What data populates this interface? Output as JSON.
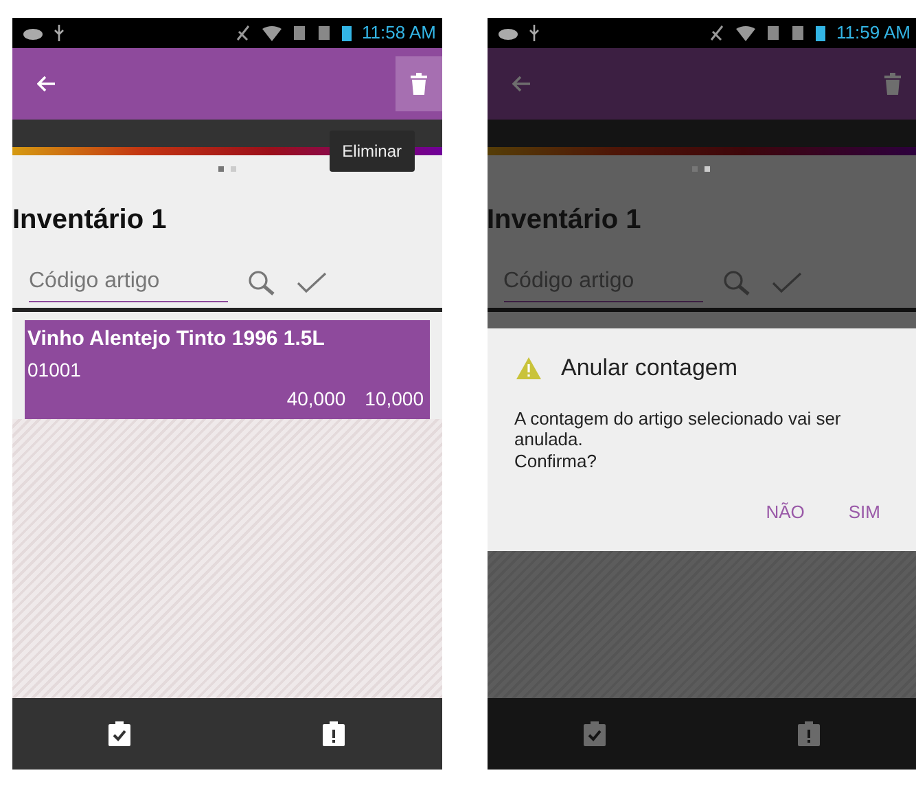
{
  "screens": [
    {
      "status_bar": {
        "time": "11:58 AM"
      },
      "app_bar": {
        "delete_pressed": true,
        "tooltip": "Eliminar"
      },
      "page_indicator": [
        {
          "selected": true
        },
        {
          "selected": false
        }
      ],
      "title": "Inventário 1",
      "search": {
        "placeholder": "Código artigo"
      },
      "items": [
        {
          "name": "Vinho Alentejo Tinto 1996 1.5L",
          "code": "01001",
          "value_1": "40,000",
          "value_2": "10,000",
          "selected": true
        }
      ]
    },
    {
      "status_bar": {
        "time": "11:59 AM"
      },
      "app_bar": {
        "delete_pressed": false
      },
      "page_indicator": [
        {
          "selected": true
        },
        {
          "selected": false
        }
      ],
      "title": "Inventário 1",
      "search": {
        "placeholder": "Código artigo"
      },
      "dialog": {
        "title": "Anular contagem",
        "message": "A contagem do artigo selecionado vai ser anulada.\nConfirma?",
        "buttons": [
          "NÃO",
          "SIM"
        ]
      }
    }
  ]
}
